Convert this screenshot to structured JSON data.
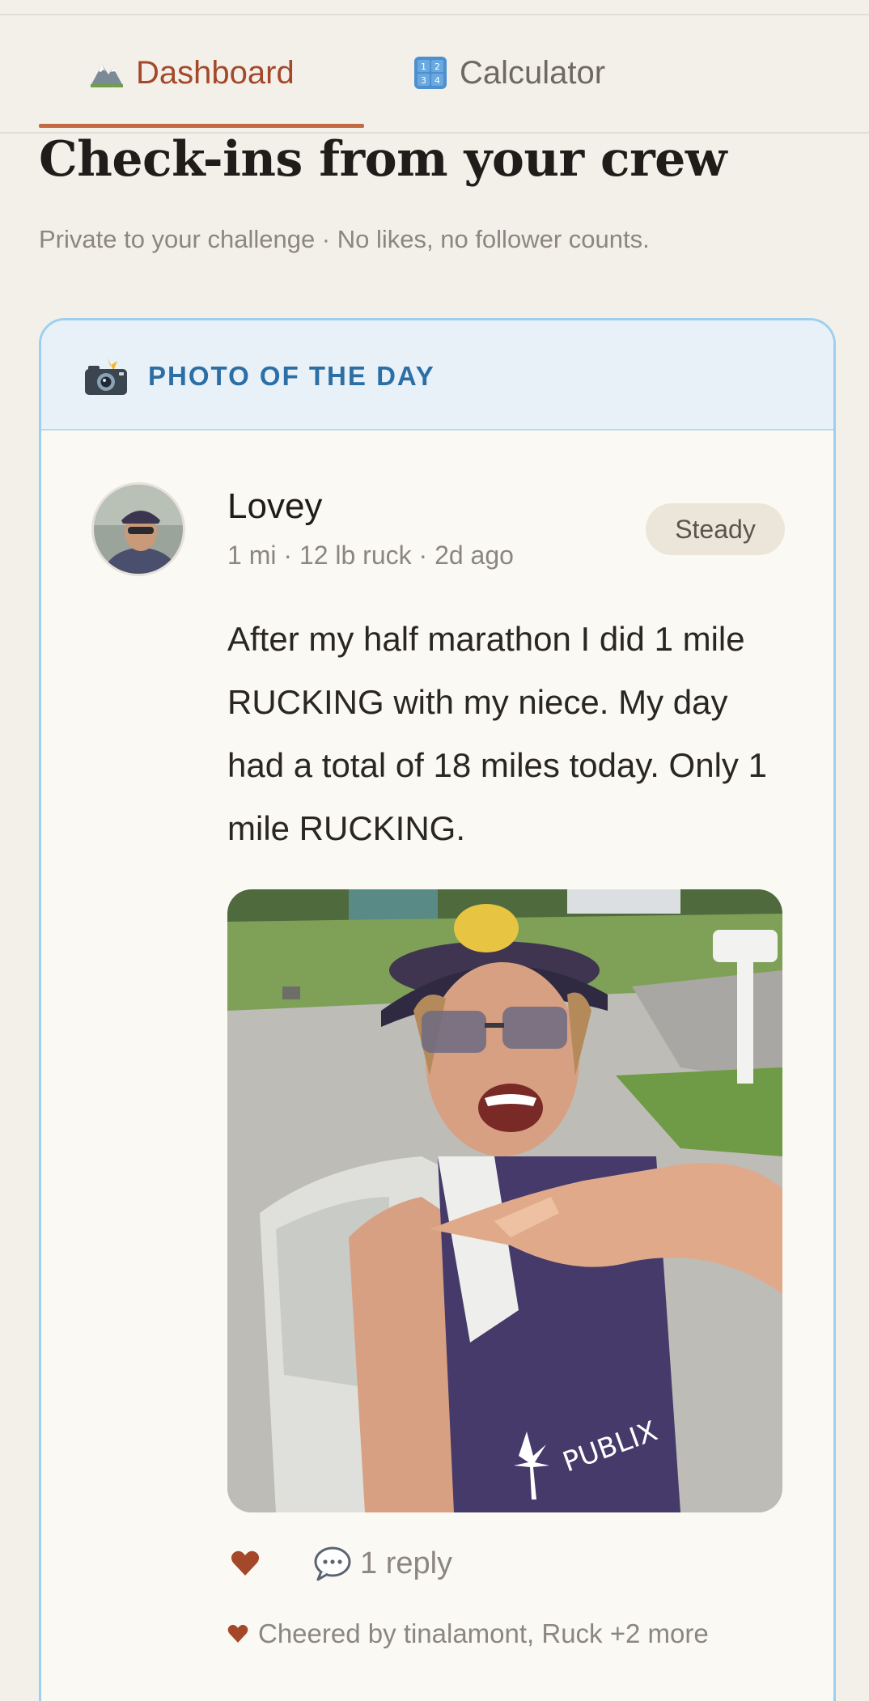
{
  "tabs": [
    {
      "label": "Dashboard",
      "icon": "mountain-icon",
      "active": true
    },
    {
      "label": "Calculator",
      "icon": "calculator-icon",
      "active": false
    }
  ],
  "header": {
    "title": "Check-ins from your crew",
    "subtitle": "Private to your challenge · No likes, no follower counts."
  },
  "featured": {
    "label": "PHOTO OF THE DAY",
    "icon": "camera-flash-icon",
    "post": {
      "author": "Lovey",
      "meta": "1 mi · 12 lb ruck · 2d ago",
      "badge": "Steady",
      "text": "After my half marathon I did 1 mile RUCKING with my niece. My day had a total of 18 miles today. Only 1 mile RUCKING.",
      "replies_label": "1 reply",
      "cheered_label": "Cheered by tinalamont, Ruck +2 more"
    }
  },
  "colors": {
    "accent": "#a5482a",
    "card_border": "#9fcff0",
    "header_blue": "#2c6fa5",
    "heart": "#a5482a"
  }
}
